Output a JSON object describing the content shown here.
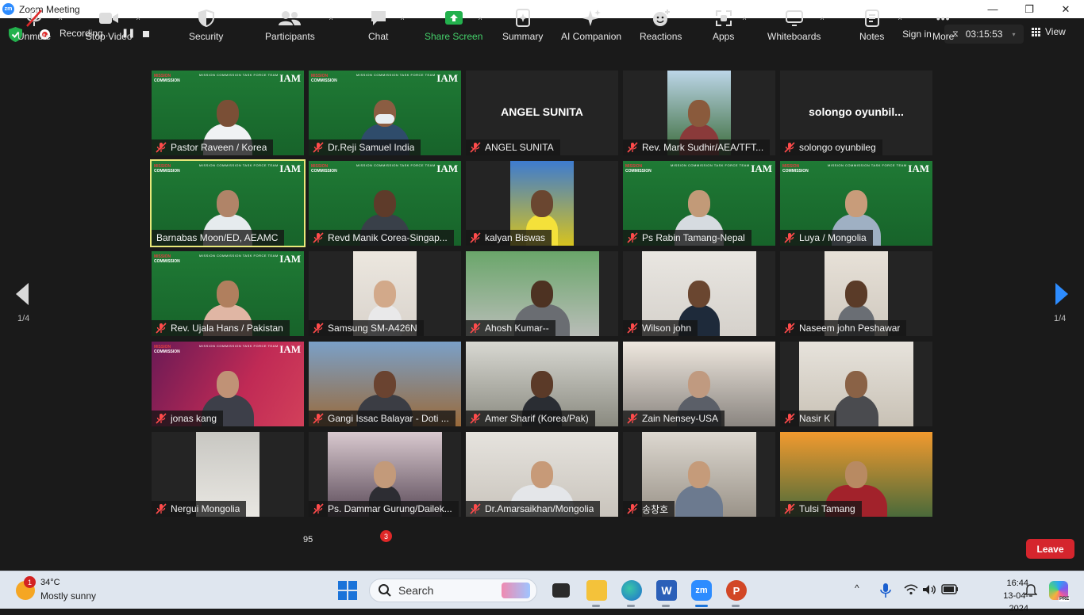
{
  "window": {
    "app_icon_text": "zm",
    "title": "Zoom Meeting",
    "minimize": "—",
    "restore": "❐",
    "close": "✕"
  },
  "topbar": {
    "recording_label": "Recording...",
    "pause_glyph": "❚❚",
    "sign_in": "Sign in",
    "timer": "03:15:53",
    "timer_glyph": "⧖",
    "timer_chevron": "▾",
    "view_label": "View"
  },
  "gallery": {
    "page_left": "1/4",
    "page_right": "1/4",
    "banner": {
      "mission": "MISSION",
      "commission": "COMMISSION",
      "task_force": "MISSION COMMISSION TASK FORCE TEAM",
      "iam": "IAM"
    },
    "tiles": [
      {
        "name": "Pastor Raveen / Korea",
        "muted": true
      },
      {
        "name": "Dr.Reji Samuel India",
        "muted": true
      },
      {
        "name": "ANGEL SUNITA",
        "big_name": "ANGEL SUNITA",
        "muted": true
      },
      {
        "name": "Rev.  Mark Sudhir/AEA/TFT...",
        "muted": true
      },
      {
        "name": "solongo oyunbileg",
        "big_name": "solongo  oyunbil...",
        "muted": true
      },
      {
        "name": "Barnabas Moon/ED, AEAMC",
        "muted": false,
        "active_speaker": true
      },
      {
        "name": "Revd Manik Corea-Singap...",
        "muted": true
      },
      {
        "name": "kalyan Biswas",
        "muted": true
      },
      {
        "name": "Ps Rabin Tamang-Nepal",
        "muted": true
      },
      {
        "name": "Luya / Mongolia",
        "muted": true
      },
      {
        "name": "Rev. Ujala Hans / Pakistan",
        "muted": true
      },
      {
        "name": "Samsung SM-A426N",
        "muted": true
      },
      {
        "name": "Ahosh Kumar--",
        "muted": true
      },
      {
        "name": "Wilson john",
        "muted": true
      },
      {
        "name": "Naseem john Peshawar",
        "muted": true
      },
      {
        "name": "jonas kang",
        "muted": true
      },
      {
        "name": "Gangi Issac Balayar - Doti ...",
        "muted": true
      },
      {
        "name": "Amer Sharif (Korea/Pak)",
        "muted": true
      },
      {
        "name": "Zain Nensey-USA",
        "muted": true
      },
      {
        "name": "Nasir K",
        "muted": true
      },
      {
        "name": "Nergui Mongolia",
        "muted": true
      },
      {
        "name": "Ps. Dammar Gurung/Dailek...",
        "muted": true
      },
      {
        "name": "Dr.Amarsaikhan/Mongolia",
        "muted": true
      },
      {
        "name": "송창호",
        "muted": true
      },
      {
        "name": "Tulsi Tamang",
        "muted": true
      }
    ]
  },
  "toolbar": {
    "unmute": "Unmute",
    "stop_video": "Stop Video",
    "security": "Security",
    "participants": "Participants",
    "participants_count": "95",
    "chat": "Chat",
    "chat_badge": "3",
    "share_screen": "Share Screen",
    "summary": "Summary",
    "ai_companion": "AI Companion",
    "reactions": "Reactions",
    "apps": "Apps",
    "whiteboards": "Whiteboards",
    "notes": "Notes",
    "more": "More",
    "more_glyph": "•••",
    "caret": "^",
    "leave": "Leave"
  },
  "taskbar": {
    "weather_badge": "1",
    "temperature": "34°C",
    "condition": "Mostly sunny",
    "search_label": "Search",
    "tray_chevron": "^",
    "time": "16:44",
    "date": "13-04-2024",
    "copilot_badge": "PRE"
  },
  "colors": {
    "zoom_blue": "#2d8cff",
    "share_green": "#44d06a",
    "leave_red": "#d5252d",
    "active_speaker": "#e8e87a"
  }
}
